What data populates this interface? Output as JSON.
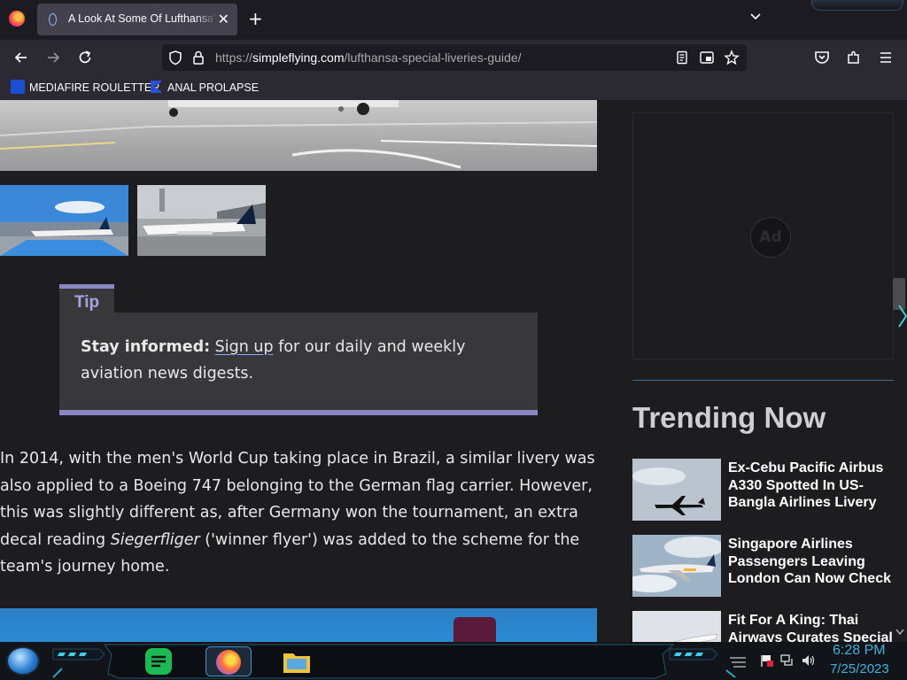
{
  "browser": {
    "tab": {
      "title": "A Look At Some Of Lufthansa's Special Liveries",
      "close": "✕"
    },
    "new_tab": "+",
    "url": {
      "prefix": "https://",
      "host": "simpleflying.com",
      "path": "/lufthansa-special-liveries-guide/"
    },
    "bookmarks": [
      {
        "label": "MEDIAFIRE ROULETTER"
      },
      {
        "label": "ANAL PROLAPSE"
      }
    ]
  },
  "article": {
    "tip": {
      "label": "Tip",
      "lead": "Stay informed:",
      "link": "Sign up",
      "rest": "for our daily and weekly aviation news digests."
    },
    "paragraph": {
      "before": "In 2014, with the men's World Cup taking place in Brazil, a similar livery was also applied to a Boeing 747 belonging to the German flag carrier. However, this was slightly different as, after Germany won the tournament, an extra decal reading ",
      "italic": "Siegerfliger",
      "after": " ('winner flyer') was added to the scheme for the team's journey home."
    }
  },
  "sidebar": {
    "ad_label": "Ad",
    "trending_title": "Trending Now",
    "trending": [
      {
        "title": "Ex-Cebu Pacific Airbus A330 Spotted In US-Bangla Airlines Livery"
      },
      {
        "title": "Singapore Airlines Passengers Leaving London Can Now Check"
      },
      {
        "title": "Fit For A King: Thai Airways Curates Special"
      }
    ]
  },
  "taskbar": {
    "time": "6:28 PM",
    "date": "7/25/2023"
  }
}
